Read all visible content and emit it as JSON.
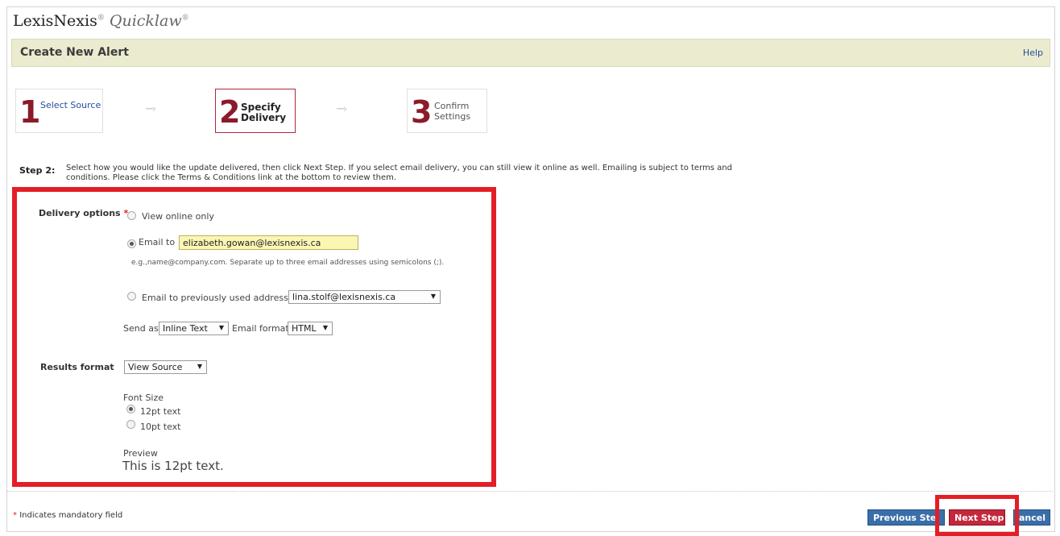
{
  "brand": {
    "name": "LexisNexis",
    "product": "Quicklaw",
    "reg_mark": "®"
  },
  "header": {
    "title": "Create New Alert",
    "help_label": "Help"
  },
  "steps": [
    {
      "number": "1",
      "label": "Select Source"
    },
    {
      "number": "2",
      "label_line1": "Specify",
      "label_line2": "Delivery"
    },
    {
      "number": "3",
      "label_line1": "Confirm",
      "label_line2": "Settings"
    }
  ],
  "instructions": {
    "label": "Step 2:",
    "text": "Select how you would like the update delivered, then click Next Step. If you select email delivery, you can still view it online as well. Emailing is subject to terms and conditions. Please click the Terms & Conditions link at the bottom to review them."
  },
  "delivery": {
    "label": "Delivery options",
    "required_mark": "*",
    "view_online_label": "View online only",
    "email_to_label": "Email to",
    "email_to_value": "elizabeth.gowan@lexisnexis.ca",
    "email_hint": "e.g.,name@company.com. Separate up to three email addresses using semicolons (;).",
    "prev_email_label": "Email to previously used address:",
    "prev_email_value": "lina.stolf@lexisnexis.ca",
    "send_as_label": "Send as",
    "send_as_value": "Inline Text",
    "email_format_label": "Email format",
    "email_format_value": "HTML"
  },
  "results": {
    "label": "Results format",
    "value": "View Source",
    "font_size_label": "Font Size",
    "option_12": "12pt text",
    "option_10": "10pt text",
    "preview_label": "Preview",
    "preview_text": "This is 12pt text."
  },
  "footer": {
    "mandatory_mark": "*",
    "mandatory_text": "Indicates mandatory field",
    "prev_button": "Previous Ste",
    "next_button": "Next Step",
    "cancel_button": "ancel"
  },
  "icons": {
    "caret": "▼",
    "step_arrow": "dotted-right-arrow"
  },
  "colors": {
    "step_number": "#8b1a2b",
    "highlight": "#e41e26",
    "title_bar": "#ebeccf",
    "email_input": "#fbf6b4",
    "blue_button": "#3a6ea8",
    "next_button": "#c4283c"
  }
}
